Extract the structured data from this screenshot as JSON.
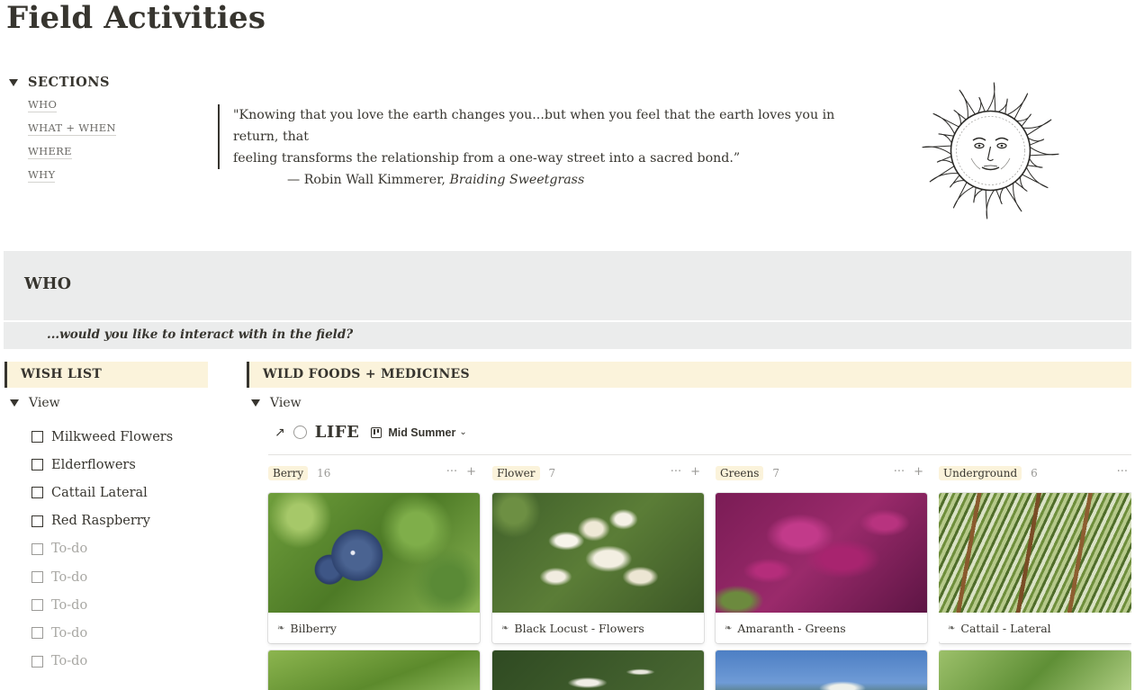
{
  "page": {
    "title": "Field Activities"
  },
  "sections": {
    "heading": "SECTIONS",
    "links": [
      "WHO",
      "WHAT + WHEN",
      "WHERE",
      "WHY"
    ]
  },
  "quote": {
    "line1": "\"Knowing that you love the earth changes you...but when you feel that the earth loves you in return, that",
    "line2": "feeling transforms the relationship from a one-way street into a sacred bond.”",
    "author": "— Robin Wall Kimmerer, ",
    "book": "Braiding Sweetgrass"
  },
  "who": {
    "title": "WHO",
    "subtitle": "...would you like to interact with in the field?"
  },
  "wish_list": {
    "heading": "WISH LIST",
    "view_label": "View",
    "items": [
      {
        "text": "Milkweed Flowers",
        "placeholder": false
      },
      {
        "text": "Elderflowers",
        "placeholder": false
      },
      {
        "text": "Cattail Lateral",
        "placeholder": false
      },
      {
        "text": "Red Raspberry",
        "placeholder": false
      },
      {
        "text": "To-do",
        "placeholder": true
      },
      {
        "text": "To-do",
        "placeholder": true
      },
      {
        "text": "To-do",
        "placeholder": true
      },
      {
        "text": "To-do",
        "placeholder": true
      },
      {
        "text": "To-do",
        "placeholder": true
      }
    ]
  },
  "wild_foods": {
    "heading": "WILD FOODS + MEDICINES",
    "view_label": "View",
    "board": {
      "arrow_icon": "↗",
      "title": "LIFE",
      "view_name": "Mid Summer",
      "chevron": "⌄"
    },
    "columns": [
      {
        "tag": "Berry",
        "count": "16",
        "card": "Bilberry",
        "image": "blueberry"
      },
      {
        "tag": "Flower",
        "count": "7",
        "card": "Black Locust - Flowers",
        "image": "white-flowers"
      },
      {
        "tag": "Greens",
        "count": "7",
        "card": "Amaranth - Greens",
        "image": "amaranth"
      },
      {
        "tag": "Underground",
        "count": "6",
        "card": "Cattail - Lateral",
        "image": "cattail"
      }
    ]
  },
  "icons": {
    "more": "···",
    "add": "+",
    "page": "❧"
  },
  "colors": {
    "text": "#37352f",
    "banner_gray": "#ebecec",
    "callout_yellow": "#fbf3db",
    "muted": "#9b9a97"
  }
}
